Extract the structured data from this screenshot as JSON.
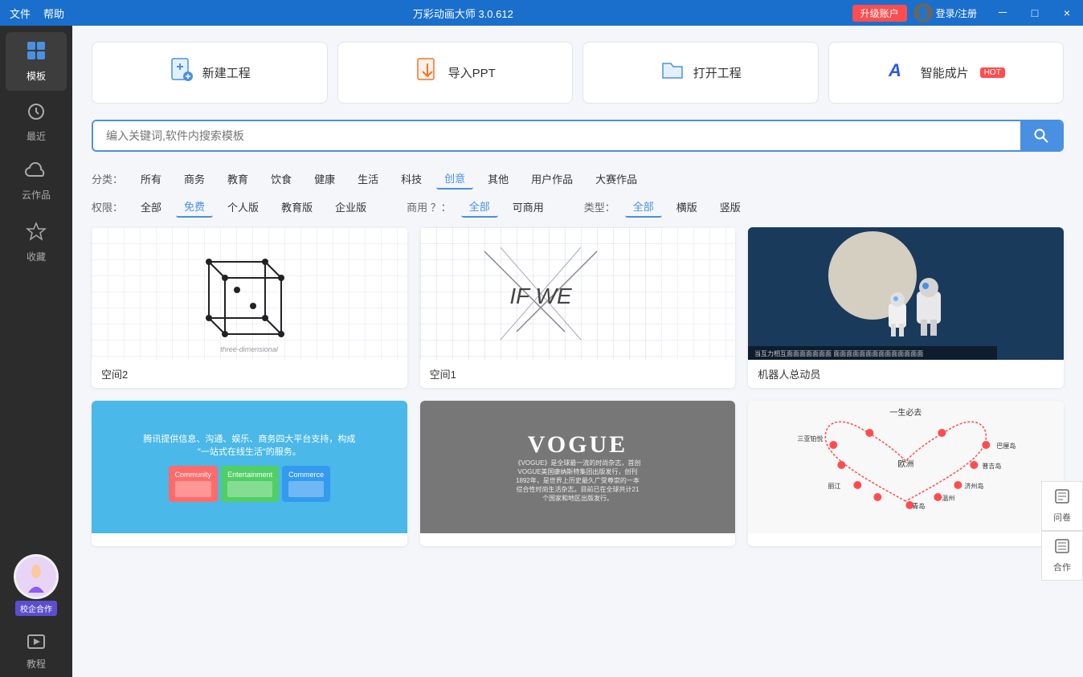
{
  "titlebar": {
    "menu": [
      "文件",
      "帮助"
    ],
    "title": "万彩动画大师 3.0.612",
    "upgrade": "升级账户",
    "user": "登录/注册",
    "controls": [
      "－",
      "□",
      "×"
    ]
  },
  "sidebar": {
    "items": [
      {
        "id": "templates",
        "label": "模板",
        "icon": "⊞",
        "active": true
      },
      {
        "id": "recent",
        "label": "最近",
        "icon": "🕐"
      },
      {
        "id": "cloud",
        "label": "云作品",
        "icon": "☁"
      },
      {
        "id": "favorites",
        "label": "收藏",
        "icon": "★"
      }
    ],
    "bottom": [
      {
        "id": "enterprise",
        "label": "校企合作",
        "icon": "🤝"
      },
      {
        "id": "tutorial",
        "label": "教程",
        "icon": "▶"
      }
    ]
  },
  "actions": [
    {
      "id": "new",
      "label": "新建工程",
      "icon": "📄+",
      "type": "new"
    },
    {
      "id": "import",
      "label": "导入PPT",
      "icon": "📊",
      "type": "import"
    },
    {
      "id": "open",
      "label": "打开工程",
      "icon": "📂",
      "type": "open"
    },
    {
      "id": "ai",
      "label": "智能成片",
      "badge": "HOT",
      "icon": "A",
      "type": "ai"
    }
  ],
  "search": {
    "placeholder": "编入关键词,软件内搜索模板"
  },
  "filters": {
    "category_label": "分类：",
    "categories": [
      "所有",
      "商务",
      "教育",
      "饮食",
      "健康",
      "生活",
      "科技",
      "创意",
      "其他",
      "用户作品",
      "大赛作品"
    ],
    "active_category": "创意",
    "license_label": "权限：",
    "licenses": [
      "全部",
      "免费",
      "个人版",
      "教育版",
      "企业版"
    ],
    "active_license": "免费",
    "commercial_label": "商用 ？：",
    "commercials": [
      "全部",
      "可商用"
    ],
    "active_commercial": "全部",
    "type_label": "类型：",
    "types": [
      "全部",
      "横版",
      "竖版"
    ],
    "active_type": "全部"
  },
  "templates": [
    {
      "id": "space2",
      "label": "空间2",
      "thumb_type": "cube"
    },
    {
      "id": "space1",
      "label": "空间1",
      "thumb_type": "space1"
    },
    {
      "id": "robot",
      "label": "机器人总动员",
      "thumb_type": "robot"
    },
    {
      "id": "tencent",
      "label": "",
      "thumb_type": "tencent"
    },
    {
      "id": "vogue",
      "label": "",
      "thumb_type": "vogue"
    },
    {
      "id": "travel",
      "label": "",
      "thumb_type": "travel"
    }
  ],
  "right_float": [
    {
      "id": "survey",
      "label": "问卷",
      "icon": "📋"
    },
    {
      "id": "cooperate",
      "label": "合作",
      "icon": "📝"
    }
  ]
}
